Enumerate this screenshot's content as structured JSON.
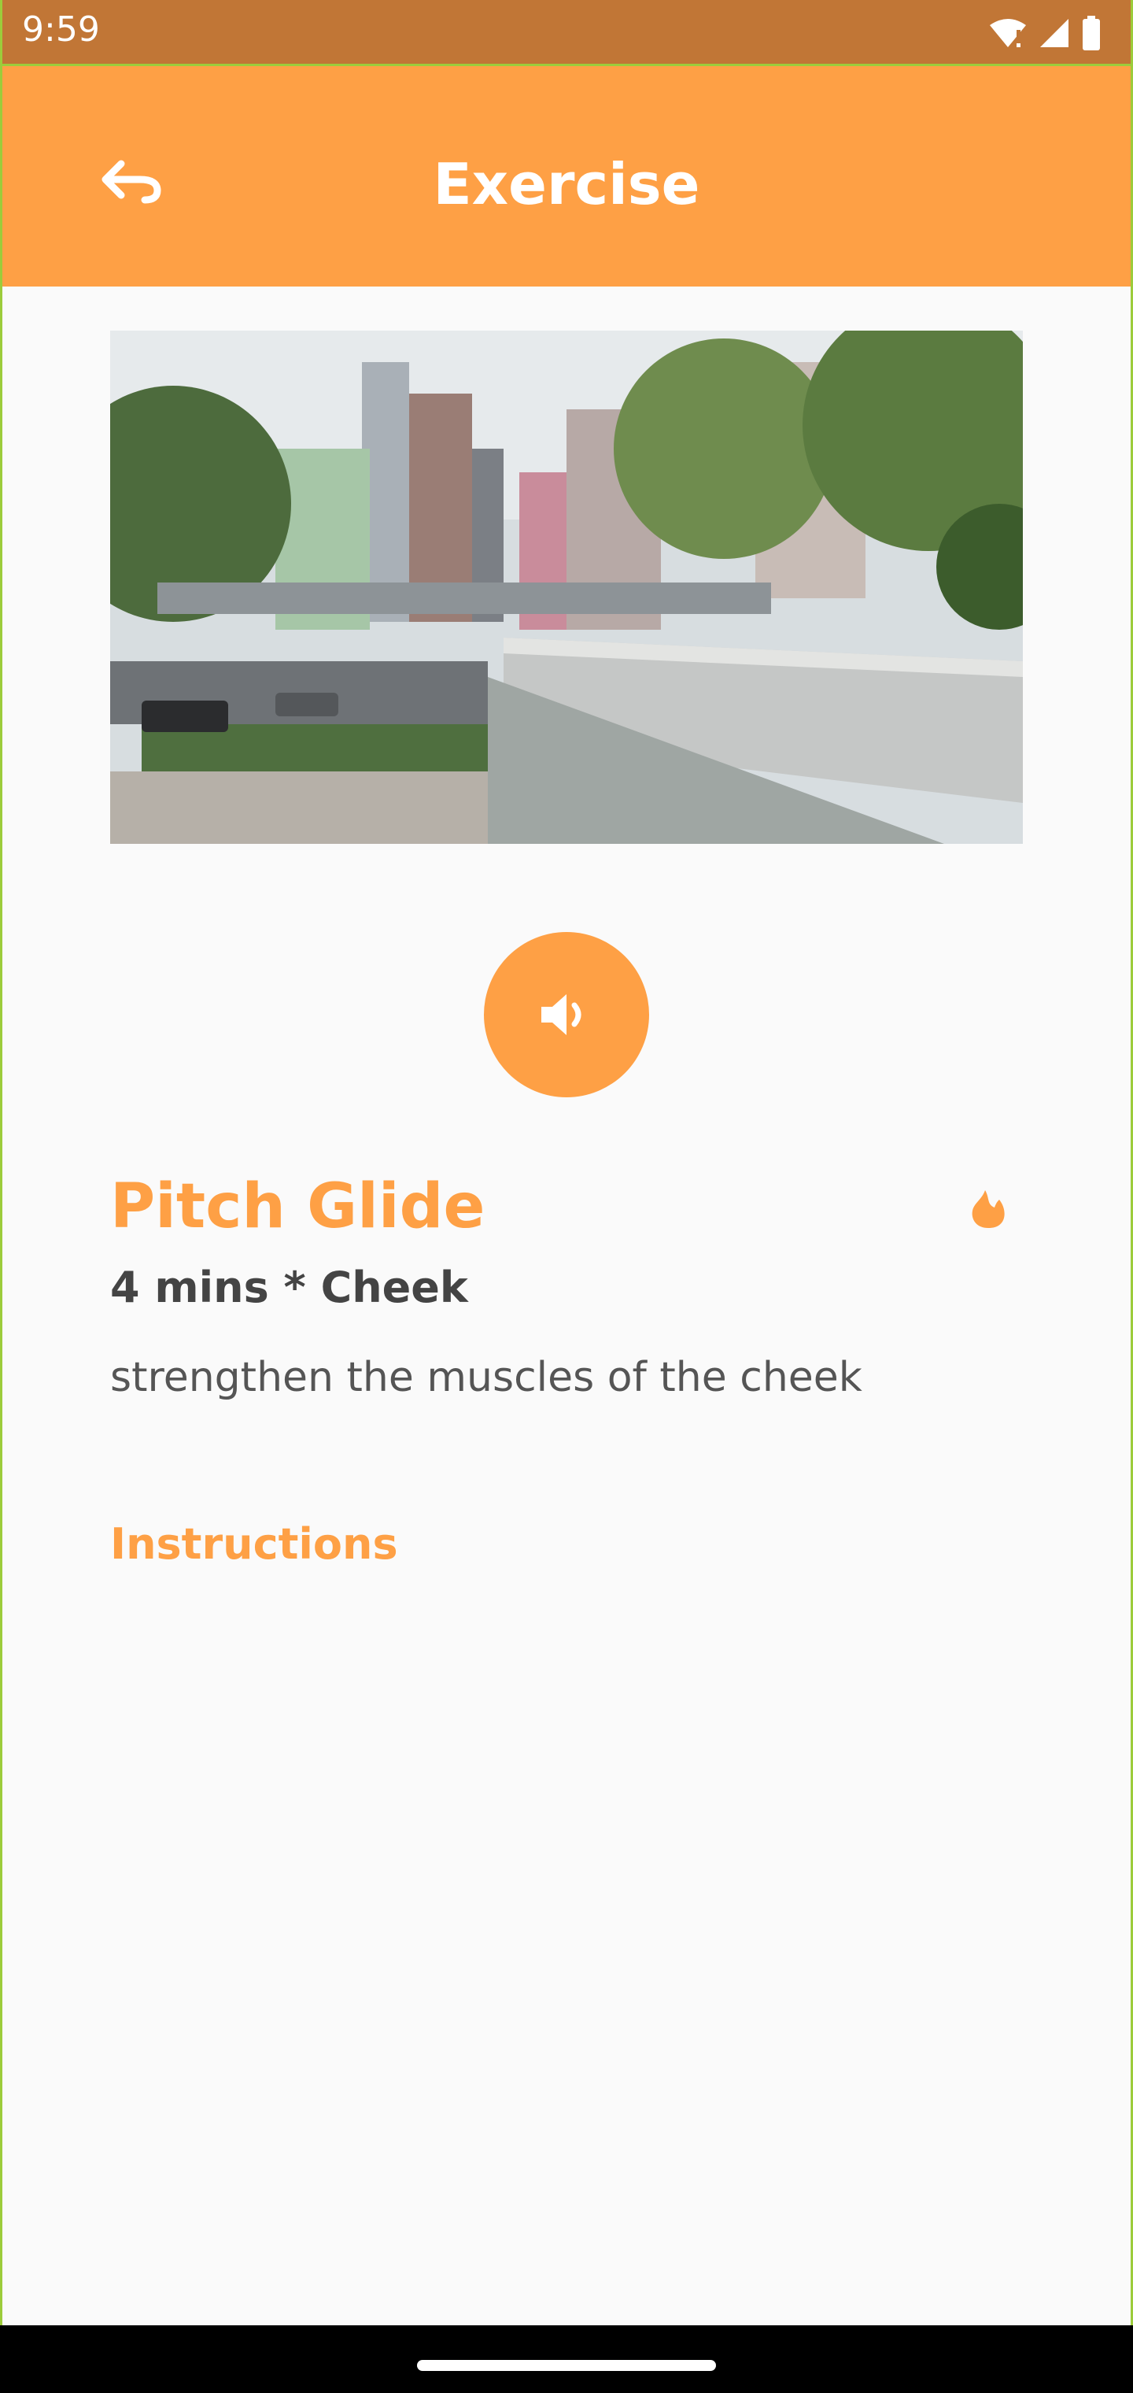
{
  "status_bar": {
    "time": "9:59"
  },
  "app_bar": {
    "title": "Exercise",
    "back_icon": "back-arrow-icon"
  },
  "colors": {
    "accent": "#fea045",
    "status_bar": "#c17636",
    "background": "#fafafa",
    "text_dark": "#444444"
  },
  "hero_image": {
    "alt": "",
    "icon": "city-photo"
  },
  "audio_button": {
    "icon": "volume-icon"
  },
  "exercise": {
    "title": "Pitch Glide",
    "meta": "4 mins * Cheek",
    "description": "strengthen the muscles of the cheek",
    "flame_icon": "flame-icon"
  },
  "instructions": {
    "heading": "Instructions"
  }
}
